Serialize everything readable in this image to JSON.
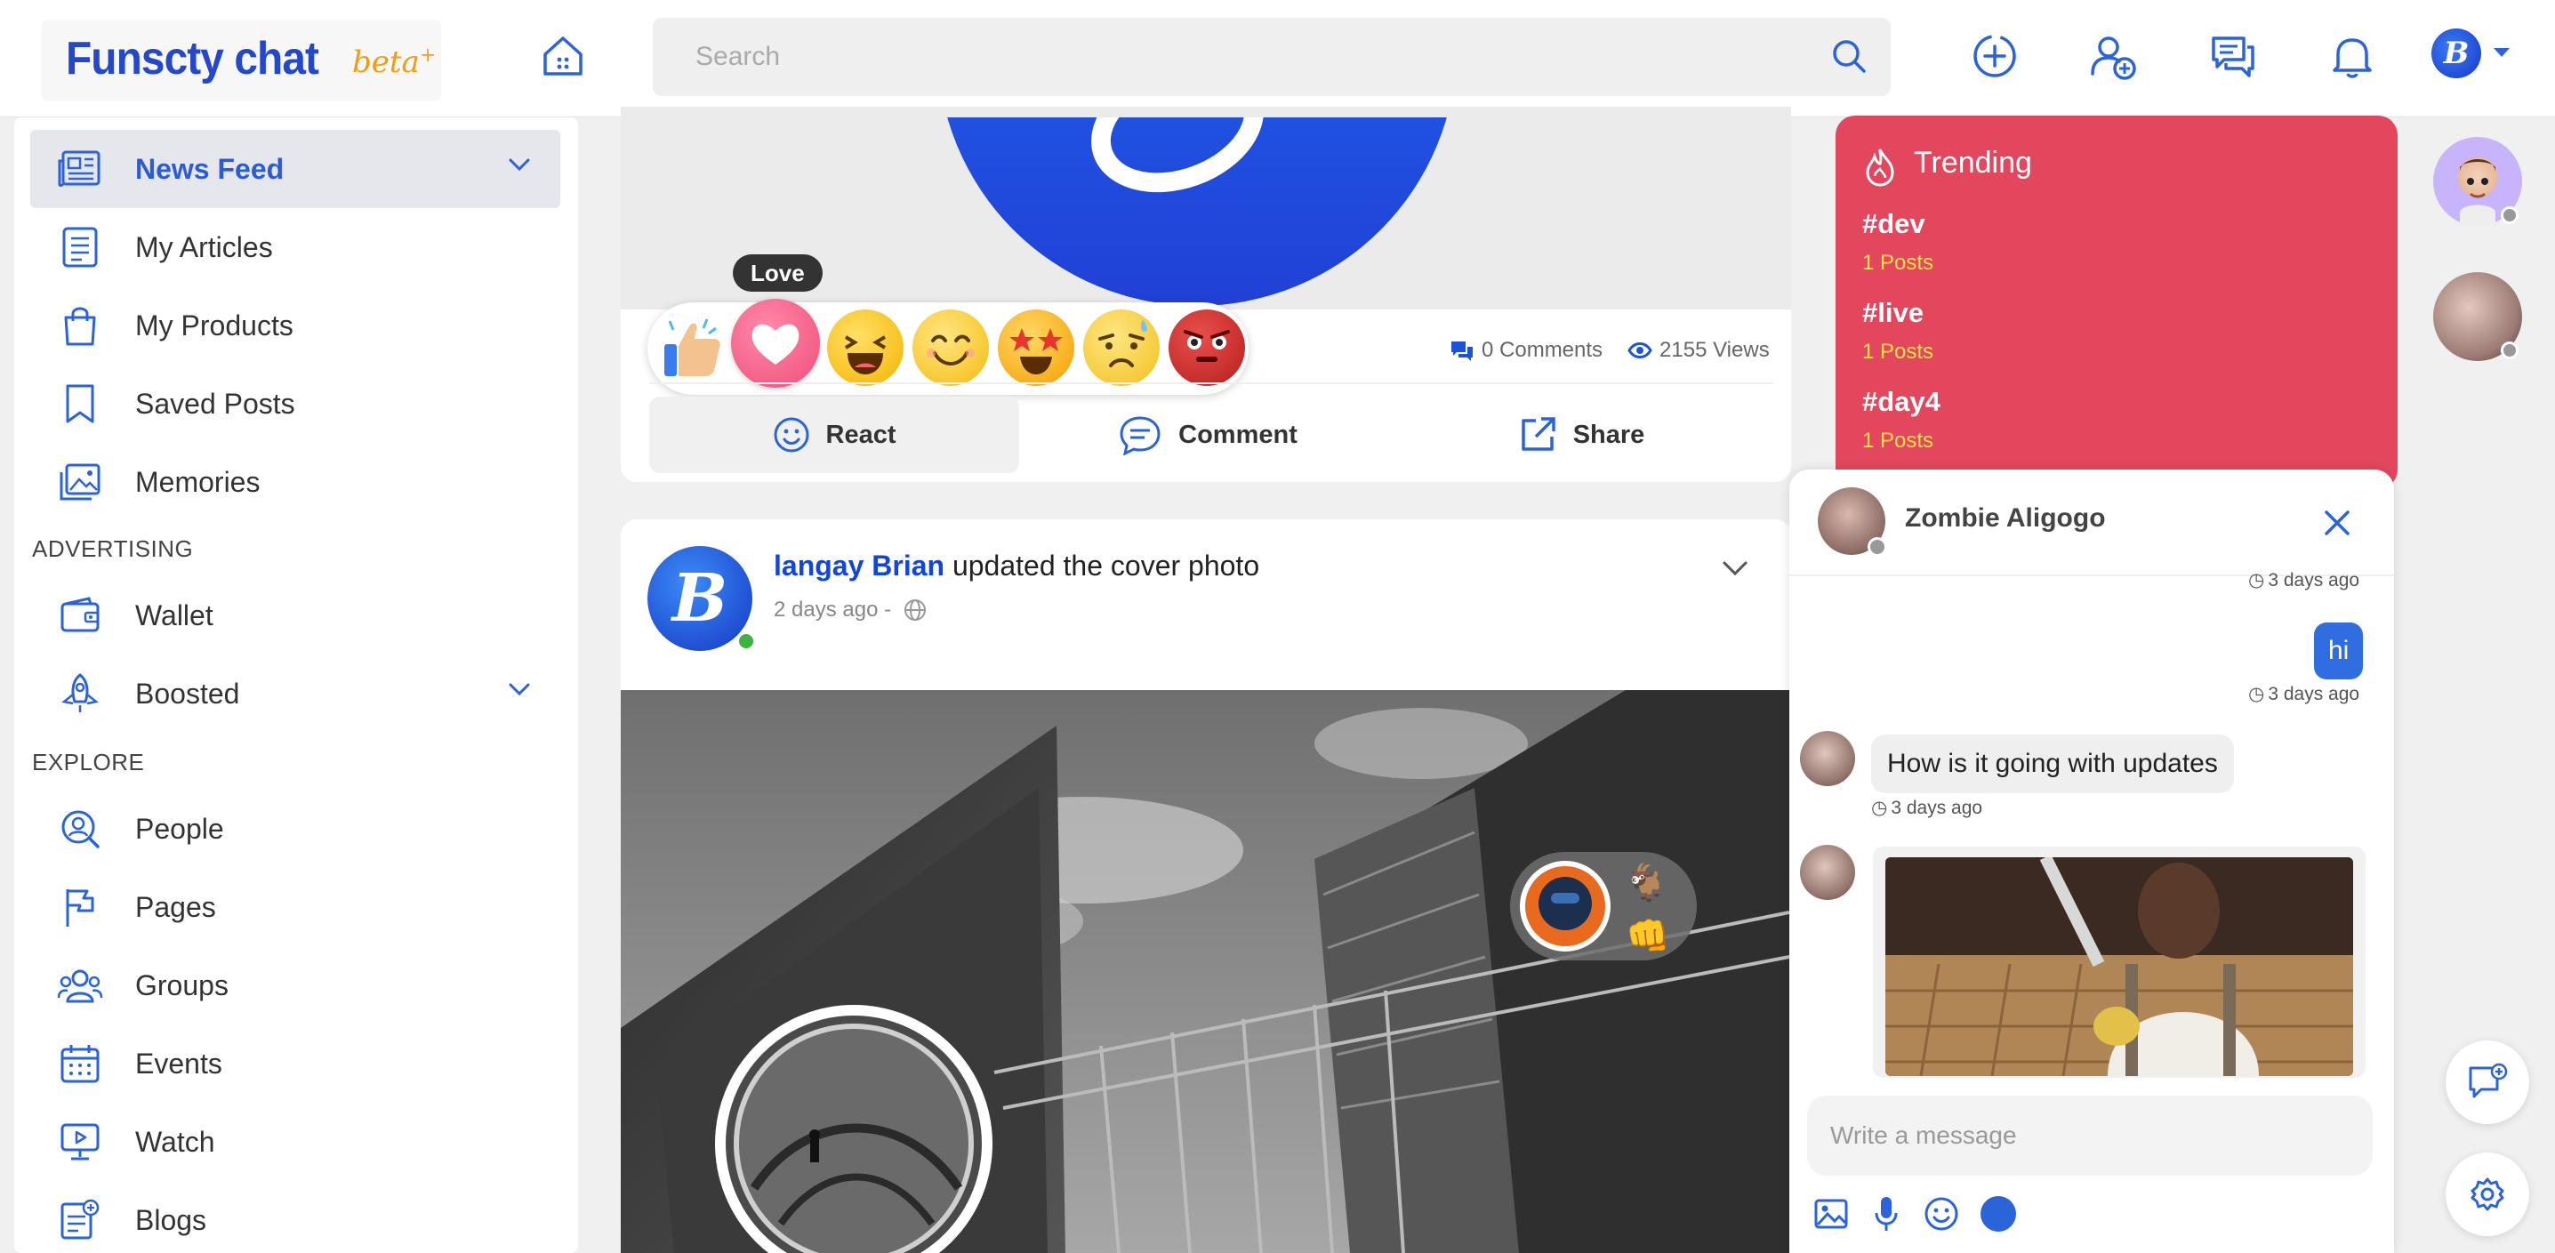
{
  "header": {
    "logo": "Funscty chat",
    "logo_badge": "beta",
    "search_placeholder": "Search",
    "user_avatar_letter": "B"
  },
  "sidebar": {
    "items_main": [
      {
        "label": "News Feed",
        "icon": "newspaper-icon",
        "active": true,
        "expandable": true
      },
      {
        "label": "My Articles",
        "icon": "article-icon"
      },
      {
        "label": "My Products",
        "icon": "shopping-bag-icon"
      },
      {
        "label": "Saved Posts",
        "icon": "bookmark-icon"
      },
      {
        "label": "Memories",
        "icon": "photos-icon"
      }
    ],
    "section_advertising": "ADVERTISING",
    "items_advertising": [
      {
        "label": "Wallet",
        "icon": "wallet-icon"
      },
      {
        "label": "Boosted",
        "icon": "rocket-icon",
        "expandable": true
      }
    ],
    "section_explore": "EXPLORE",
    "items_explore": [
      {
        "label": "People",
        "icon": "people-search-icon"
      },
      {
        "label": "Pages",
        "icon": "flag-icon"
      },
      {
        "label": "Groups",
        "icon": "groups-icon"
      },
      {
        "label": "Events",
        "icon": "calendar-icon"
      },
      {
        "label": "Watch",
        "icon": "video-icon"
      },
      {
        "label": "Blogs",
        "icon": "blog-icon"
      }
    ]
  },
  "feed": {
    "reaction_tooltip": "Love",
    "reactions": [
      "like",
      "love",
      "haha",
      "wow-smile",
      "star-struck",
      "sad",
      "angry"
    ],
    "comments": "0 Comments",
    "views": "2155 Views",
    "actions": {
      "react": "React",
      "comment": "Comment",
      "share": "Share"
    },
    "post": {
      "author": "langay Brian",
      "action_text": "updated the cover photo",
      "time": "2 days ago -",
      "avatar_letter": "B"
    }
  },
  "trending": {
    "title": "Trending",
    "tags": [
      {
        "tag": "#dev",
        "count": "1 Posts"
      },
      {
        "tag": "#live",
        "count": "1 Posts"
      },
      {
        "tag": "#day4",
        "count": "1 Posts"
      }
    ]
  },
  "chat": {
    "name": "Zombie Aligogo",
    "messages": [
      {
        "time": "3 days ago"
      },
      {
        "from": "me",
        "text": "hi",
        "time": "3 days ago"
      },
      {
        "from": "them",
        "text": "How is it going with updates",
        "time": "3 days ago"
      }
    ],
    "input_placeholder": "Write a message"
  },
  "colors": {
    "brand_blue": "#2547c9",
    "accent_blue": "#2b63d9",
    "trending_red": "#e3475d",
    "trending_count": "#ffe14a",
    "online_green": "#3fb33f"
  }
}
